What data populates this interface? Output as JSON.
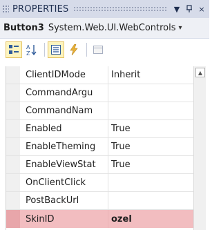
{
  "panel": {
    "title": "PROPERTIES",
    "pin_glyph": "ʔ",
    "close_glyph": "×",
    "dropdown_glyph": "▼"
  },
  "object": {
    "name": "Button3",
    "type": "System.Web.UI.WebControls"
  },
  "toolbar": {
    "buttons": [
      {
        "name": "categorized-view-icon",
        "active": true
      },
      {
        "name": "alphabetical-sort-icon",
        "active": false
      },
      {
        "name": "properties-icon",
        "active": true
      },
      {
        "name": "events-icon",
        "active": false
      },
      {
        "name": "property-pages-icon",
        "active": false
      }
    ]
  },
  "properties": [
    {
      "name": "ClientIDMode",
      "value": "Inherit"
    },
    {
      "name": "CommandArgu",
      "value": ""
    },
    {
      "name": "CommandNam",
      "value": ""
    },
    {
      "name": "Enabled",
      "value": "True"
    },
    {
      "name": "EnableTheming",
      "value": "True"
    },
    {
      "name": "EnableViewStat",
      "value": "True"
    },
    {
      "name": "OnClientClick",
      "value": ""
    },
    {
      "name": "PostBackUrl",
      "value": ""
    },
    {
      "name": "SkinID",
      "value": "ozel",
      "selected": true
    }
  ],
  "colors": {
    "title_bg": "#d6dbe9",
    "selected_row": "#f2bdc0",
    "active_button": "#fdf4bf"
  }
}
